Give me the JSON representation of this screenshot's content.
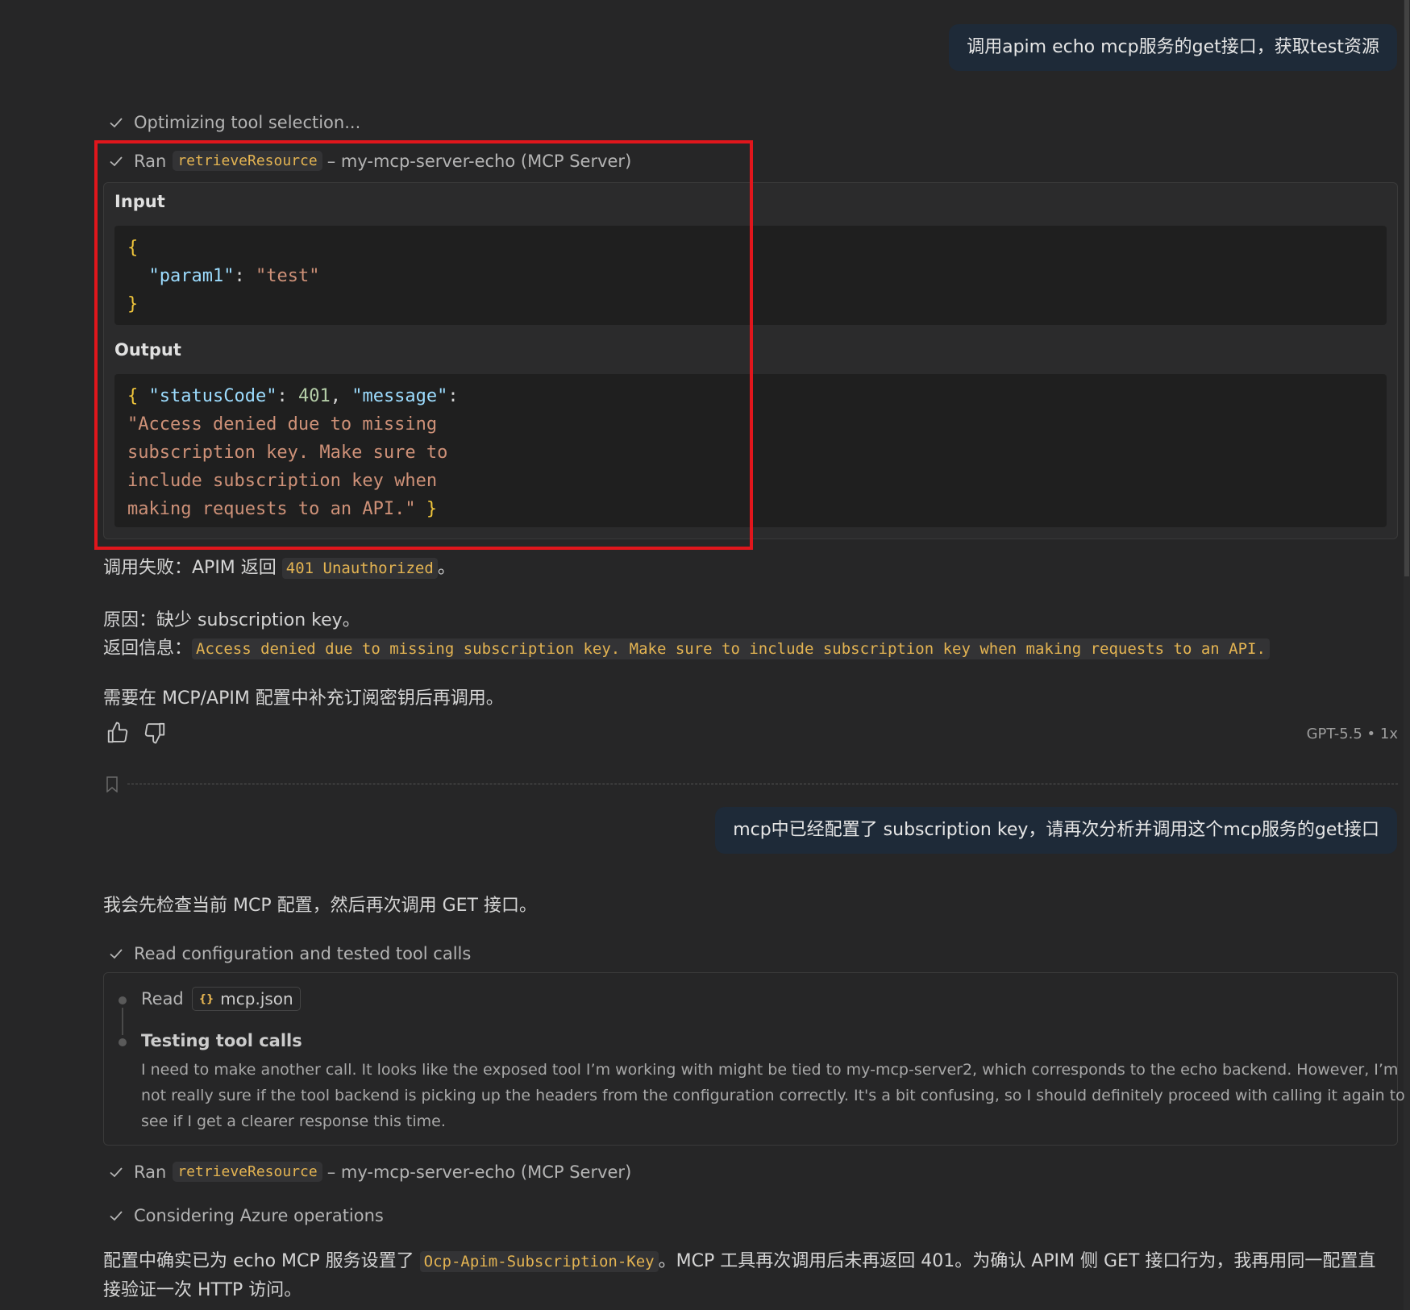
{
  "messages": {
    "user1": "调用apim echo mcp服务的get接口，获取test资源",
    "user2": "mcp中已经配置了 subscription key，请再次分析并调用这个mcp服务的get接口"
  },
  "steps": {
    "optimizing": "Optimizing tool selection...",
    "ran_prefix": "Ran",
    "ran_tool": "retrieveResource",
    "ran_suffix": "– my-mcp-server-echo (MCP Server)",
    "read_config": "Read configuration and tested tool calls",
    "considering": "Considering Azure operations"
  },
  "tool_call": {
    "input_label": "Input",
    "output_label": "Output",
    "input_key": "\"param1\"",
    "input_value": "\"test\"",
    "out_key1": "\"statusCode\"",
    "out_val1": "401",
    "out_key2": "\"message\"",
    "out_msg_lines": [
      "\"Access denied due to missing",
      "subscription key. Make sure to",
      "include subscription key when",
      "making requests to an API.\""
    ]
  },
  "response1": {
    "fail_prefix": "调用失败：APIM 返回",
    "fail_code": "401 Unauthorized",
    "fail_suffix": "。",
    "reason": "原因：缺少 subscription key。",
    "return_prefix": "返回信息：",
    "return_msg": "Access denied due to missing subscription key. Make sure to include subscription key when making requests to an API.",
    "advice": "需要在 MCP/APIM 配置中补充订阅密钥后再调用。"
  },
  "feedback": {
    "model_info": "GPT-5.5 • 1x"
  },
  "response2": {
    "intro": "我会先检查当前 MCP 配置，然后再次调用 GET 接口。",
    "read_label": "Read",
    "file_name": "mcp.json",
    "testing_title": "Testing tool calls",
    "testing_lines": [
      "I need to make another call. It looks like the exposed tool I’m working with might be tied to my-mcp-server2, which corresponds to the echo backend. However, I’m",
      "not really sure if the tool backend is picking up the headers from the configuration correctly. It's a bit confusing, so I should definitely proceed with calling it again to",
      "see if I get a clearer response this time."
    ],
    "final_prefix": "配置中确实已为 echo MCP 服务设置了",
    "final_code": "Ocp-Apim-Subscription-Key",
    "final_suffix": "。MCP 工具再次调用后未再返回 401。为确认 APIM 侧 GET 接口行为，我再用同一配置直",
    "final_line2": "接验证一次 HTTP 访问。"
  }
}
